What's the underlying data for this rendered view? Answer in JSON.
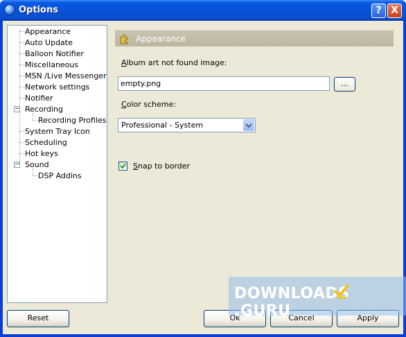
{
  "window": {
    "title": "Options"
  },
  "titlebar_buttons": {
    "help": "?",
    "close": "X"
  },
  "tree": {
    "items": [
      {
        "label": "Appearance"
      },
      {
        "label": "Auto Update"
      },
      {
        "label": "Balloon Notifier"
      },
      {
        "label": "Miscellaneous"
      },
      {
        "label": "MSN /Live Messenger"
      },
      {
        "label": "Network settings"
      },
      {
        "label": "Notifier"
      },
      {
        "label": "Recording"
      },
      {
        "label": "Recording Profiles"
      },
      {
        "label": "System Tray Icon"
      },
      {
        "label": "Scheduling"
      },
      {
        "label": "Hot keys"
      },
      {
        "label": "Sound"
      },
      {
        "label": "DSP Addins"
      }
    ],
    "expanders": {
      "recording": "−",
      "sound": "−"
    }
  },
  "panel": {
    "header": "Appearance",
    "album_art_label": "Album art not found image:",
    "album_art_accel": "A",
    "album_art_rest": "lbum art not found image:",
    "album_art_value": "empty.png",
    "browse_label": "...",
    "color_scheme_accel": "C",
    "color_scheme_rest": "olor scheme:",
    "color_scheme_value": "Professional - System",
    "snap_accel": "S",
    "snap_rest": "nap to border",
    "snap_checked": true
  },
  "buttons": {
    "reset": "Reset",
    "ok": "Ok",
    "cancel": "Cancel",
    "apply": "Apply"
  },
  "watermark": {
    "text": "DOWNLOADS",
    "suffix": ".GURU"
  },
  "colors": {
    "title_blue": "#0a5ae6",
    "face": "#ece9d8",
    "header_gray": "#c2bca8"
  }
}
